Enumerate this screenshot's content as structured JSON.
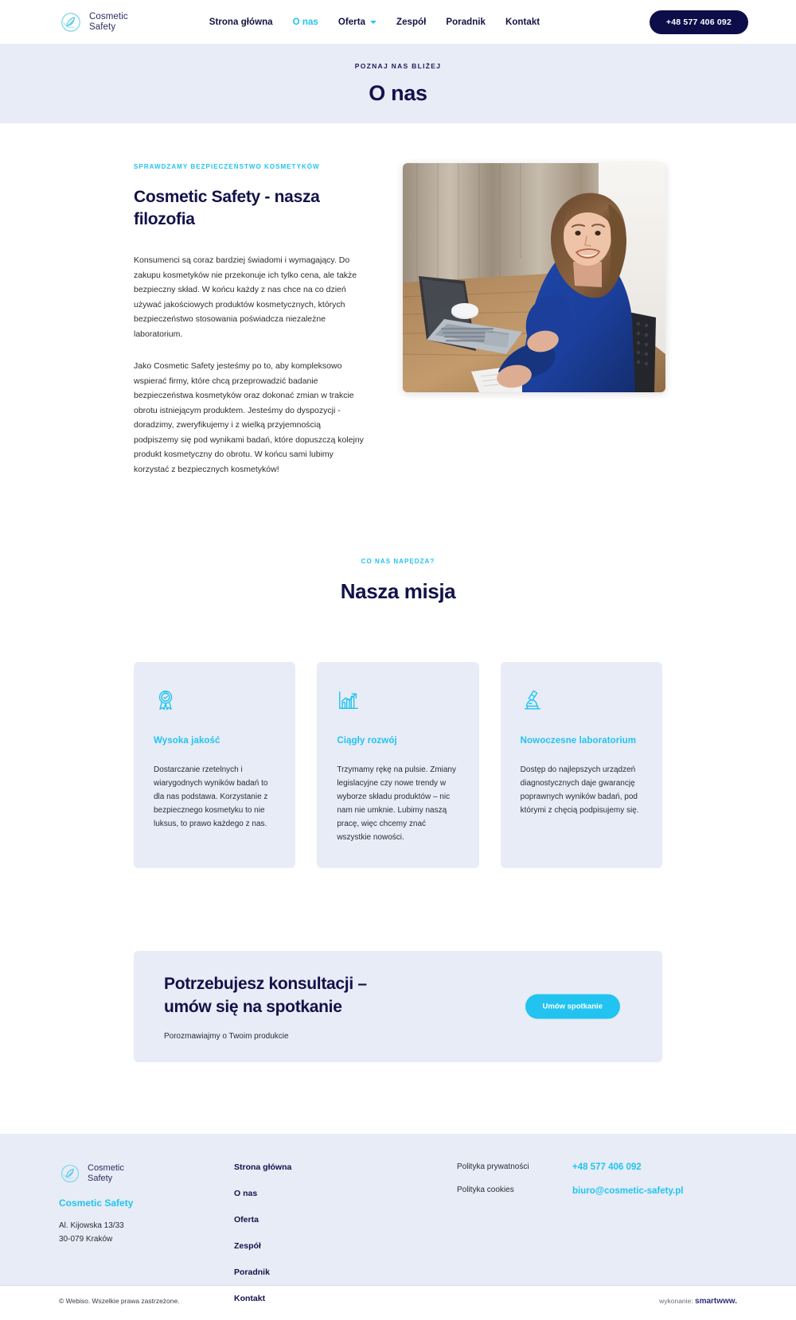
{
  "header": {
    "logo": {
      "icon": "leaf-circle-logo-icon",
      "line1": "Cosmetic",
      "line2": "Safety"
    },
    "nav": [
      {
        "label": "Strona główna",
        "active": false,
        "caret": false
      },
      {
        "label": "O nas",
        "active": true,
        "caret": false
      },
      {
        "label": "Oferta",
        "active": false,
        "caret": true
      },
      {
        "label": "Zespół",
        "active": false,
        "caret": false
      },
      {
        "label": "Poradnik",
        "active": false,
        "caret": false
      },
      {
        "label": "Kontakt",
        "active": false,
        "caret": false
      }
    ],
    "phone_button": "+48 577 406 092"
  },
  "hero": {
    "eyebrow": "POZNAJ NAS BLIŻEJ",
    "title": "O nas"
  },
  "about": {
    "eyebrow": "SPRAWDZAMY BEZPIECZEŃSTWO KOSMETYKÓW",
    "title": "Cosmetic Safety - nasza filozofia",
    "paragraph1": "Konsumenci są coraz bardziej świadomi i wymagający. Do zakupu kosmetyków nie przekonuje ich tylko cena, ale także bezpieczny skład. W końcu każdy z nas chce na co dzień używać jakościowych produktów kosmetycznych, których bezpieczeństwo stosowania poświadcza niezależne laboratorium.",
    "paragraph2": "Jako Cosmetic Safety jesteśmy po to, aby kompleksowo wspierać firmy, które chcą przeprowadzić badanie bezpieczeństwa kosmetyków oraz dokonać zmian w trakcie obrotu istniejącym produktem. Jesteśmy do dyspozycji - doradzimy, zweryfikujemy i z wielką przyjemnością podpiszemy się pod wynikami badań, które dopuszczą kolejny produkt kosmetyczny do obrotu. W końcu sami lubimy korzystać z bezpiecznych kosmetyków!",
    "photo_alt": "Kobieta w niebieskim swetrze przy biurku z laptopem"
  },
  "mission": {
    "eyebrow": "CO NAS NAPĘDZA?",
    "title": "Nasza misja",
    "cards": [
      {
        "icon": "award-ribbon-icon",
        "title": "Wysoka jakość",
        "text": "Dostarczanie rzetelnych i wiarygodnych wyników badań to dla nas podstawa. Korzystanie z bezpiecznego kosmetyku to nie luksus, to prawo każdego z nas."
      },
      {
        "icon": "growth-chart-icon",
        "title": "Ciągły rozwój",
        "text": "Trzymamy rękę na pulsie. Zmiany legislacyjne czy nowe trendy w wyborze składu produktów – nic nam nie umknie. Lubimy naszą pracę, więc chcemy znać wszystkie nowości."
      },
      {
        "icon": "microscope-icon",
        "title": "Nowoczesne laboratorium",
        "text": "Dostęp do najlepszych urządzeń diagnostycznych daje gwarancję poprawnych wyników badań, pod którymi z chęcią podpisujemy się."
      }
    ]
  },
  "cta": {
    "title_line1": "Potrzebujesz konsultacji –",
    "title_line2": "umów się na spotkanie",
    "subtitle": "Porozmawiajmy o Twoim produkcie",
    "button": "Umów spotkanie"
  },
  "footer": {
    "logo": {
      "icon": "leaf-circle-logo-icon",
      "line1": "Cosmetic",
      "line2": "Safety"
    },
    "brand_name": "Cosmetic Safety",
    "address_line1": "Al. Kijowska 13/33",
    "address_line2": "30-079 Kraków",
    "nav": [
      "Strona główna",
      "O nas",
      "Oferta",
      "Zespół",
      "Poradnik",
      "Kontakt"
    ],
    "legal": [
      "Polityka prywatności",
      "Polityka cookies"
    ],
    "contact": {
      "phone": "+48 577 406 092",
      "email": "biuro@cosmetic-safety.pl"
    },
    "copyright": "© Webiso. Wszelkie prawa zastrzeżone.",
    "made_by_label": "wykonanie:",
    "made_by_brand": "smartwww."
  },
  "colors": {
    "accent_cyan": "#22c3f0",
    "navy": "#12124a",
    "panel_blue": "#e7ecf6",
    "dark_button": "#0d0d4a"
  }
}
